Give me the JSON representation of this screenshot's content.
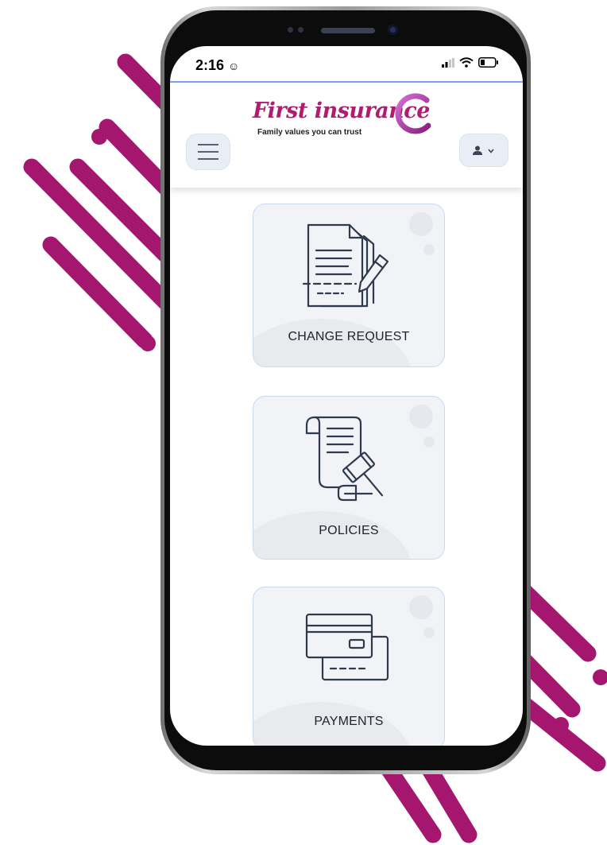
{
  "status_bar": {
    "time": "2:16",
    "icons": [
      "face-icon",
      "signal-icon",
      "wifi-icon",
      "battery-icon"
    ]
  },
  "header": {
    "logo_title": "First insurance",
    "logo_tagline": "Family values you can trust",
    "menu_icon": "hamburger-icon",
    "user_icon": "user-icon"
  },
  "cards": [
    {
      "label": "CHANGE REQUEST",
      "icon": "document-pen-icon"
    },
    {
      "label": "POLICIES",
      "icon": "scroll-gavel-icon"
    },
    {
      "label": "PAYMENTS",
      "icon": "cards-icon"
    }
  ],
  "colors": {
    "brand": "#b01c6e",
    "decor_stripes": "#a5176f",
    "header_line": "#7f9ef0",
    "card_bg": "#f2f3f6",
    "card_border": "#cbd8f1",
    "icon_stroke": "#2f3a4e"
  }
}
